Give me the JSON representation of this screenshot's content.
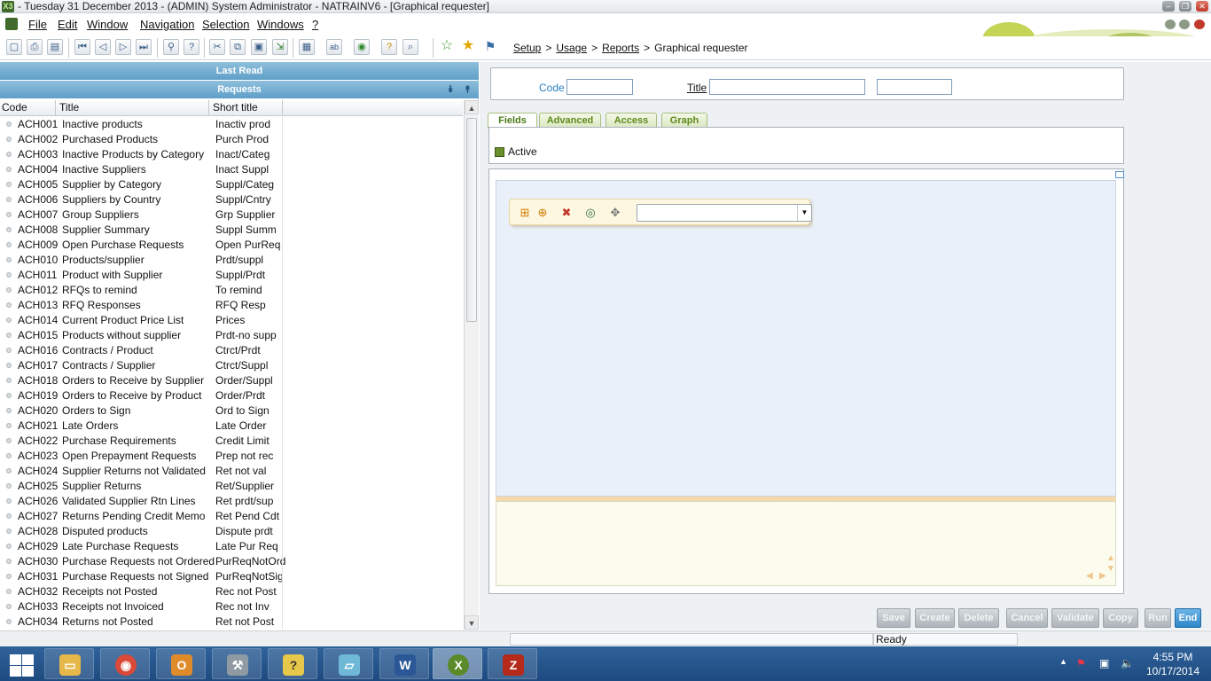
{
  "window": {
    "title": "- Tuesday 31 December 2013 - (ADMIN) System Administrator - NATRAINV6 - [Graphical requester]",
    "app_icon": "X3"
  },
  "menu": [
    "File",
    "Edit",
    "Window",
    "Navigation",
    "Selection",
    "Windows",
    "?"
  ],
  "breadcrumb": {
    "items": [
      "Setup",
      "Usage",
      "Reports"
    ],
    "current": "Graphical requester",
    "sep": ">"
  },
  "left_panel": {
    "last_read": "Last Read",
    "requests": "Requests",
    "columns": [
      "Code",
      "Title",
      "Short title"
    ],
    "rows": [
      {
        "code": "ACH001",
        "title": "Inactive products",
        "short": "Inactiv prod"
      },
      {
        "code": "ACH002",
        "title": "Purchased Products",
        "short": "Purch Prod"
      },
      {
        "code": "ACH003",
        "title": "Inactive Products by Category",
        "short": "Inact/Categ"
      },
      {
        "code": "ACH004",
        "title": "Inactive Suppliers",
        "short": "Inact Suppl"
      },
      {
        "code": "ACH005",
        "title": "Supplier by Category",
        "short": "Suppl/Categ"
      },
      {
        "code": "ACH006",
        "title": "Suppliers by Country",
        "short": "Suppl/Cntry"
      },
      {
        "code": "ACH007",
        "title": "Group Suppliers",
        "short": "Grp Supplier"
      },
      {
        "code": "ACH008",
        "title": "Supplier Summary",
        "short": "Suppl Summ"
      },
      {
        "code": "ACH009",
        "title": "Open Purchase Requests",
        "short": "Open PurReq"
      },
      {
        "code": "ACH010",
        "title": "Products/supplier",
        "short": "Prdt/suppl"
      },
      {
        "code": "ACH011",
        "title": "Product with Supplier",
        "short": "Suppl/Prdt"
      },
      {
        "code": "ACH012",
        "title": "RFQs to remind",
        "short": "To remind"
      },
      {
        "code": "ACH013",
        "title": "RFQ Responses",
        "short": "RFQ Resp"
      },
      {
        "code": "ACH014",
        "title": "Current Product Price List",
        "short": "Prices"
      },
      {
        "code": "ACH015",
        "title": "Products without supplier",
        "short": "Prdt-no supp"
      },
      {
        "code": "ACH016",
        "title": "Contracts / Product",
        "short": "Ctrct/Prdt"
      },
      {
        "code": "ACH017",
        "title": "Contracts / Supplier",
        "short": "Ctrct/Suppl"
      },
      {
        "code": "ACH018",
        "title": "Orders to Receive by Supplier",
        "short": "Order/Suppl"
      },
      {
        "code": "ACH019",
        "title": "Orders to Receive by Product",
        "short": "Order/Prdt"
      },
      {
        "code": "ACH020",
        "title": "Orders to Sign",
        "short": "Ord to Sign"
      },
      {
        "code": "ACH021",
        "title": "Late Orders",
        "short": "Late Order"
      },
      {
        "code": "ACH022",
        "title": "Purchase Requirements",
        "short": "Credit Limit"
      },
      {
        "code": "ACH023",
        "title": "Open Prepayment Requests",
        "short": "Prep not rec"
      },
      {
        "code": "ACH024",
        "title": "Supplier Returns not Validated",
        "short": "Ret not val"
      },
      {
        "code": "ACH025",
        "title": "Supplier Returns",
        "short": "Ret/Supplier"
      },
      {
        "code": "ACH026",
        "title": "Validated Supplier Rtn Lines",
        "short": "Ret prdt/sup"
      },
      {
        "code": "ACH027",
        "title": "Returns Pending Credit Memo",
        "short": "Ret Pend Cdt"
      },
      {
        "code": "ACH028",
        "title": "Disputed products",
        "short": "Dispute prdt"
      },
      {
        "code": "ACH029",
        "title": "Late Purchase Requests",
        "short": "Late Pur Req"
      },
      {
        "code": "ACH030",
        "title": "Purchase Requests not Ordered",
        "short": "PurReqNotOrd"
      },
      {
        "code": "ACH031",
        "title": "Purchase Requests not Signed",
        "short": "PurReqNotSig"
      },
      {
        "code": "ACH032",
        "title": "Receipts not Posted",
        "short": "Rec not Post"
      },
      {
        "code": "ACH033",
        "title": "Receipts not Invoiced",
        "short": "Rec not Inv"
      },
      {
        "code": "ACH034",
        "title": "Returns not Posted",
        "short": "Ret not Post"
      }
    ]
  },
  "form": {
    "code_label": "Code",
    "code_value": "",
    "title_label": "Title",
    "title_value": "",
    "title_extra": "",
    "tabs": [
      "Fields",
      "Advanced",
      "Access",
      "Graph"
    ],
    "active_tab": "Fields",
    "active_label": "Active",
    "active_checked": true,
    "graph_select_value": ""
  },
  "buttons": [
    "Save",
    "Create",
    "Delete",
    "Cancel",
    "Validate",
    "Copy",
    "Run",
    "End"
  ],
  "status": {
    "text": "Ready"
  },
  "taskbar": {
    "time": "4:55 PM",
    "date": "10/17/2014",
    "apps": [
      "file-explorer",
      "chrome",
      "outlook",
      "tools",
      "help",
      "notepad",
      "word",
      "sage-x3",
      "filezilla"
    ]
  },
  "colors": {
    "accent_blue": "#5f9fc8",
    "tab_green": "#5f8a1d",
    "primary_button": "#2e86c8",
    "taskbar": "#1d4a80"
  }
}
